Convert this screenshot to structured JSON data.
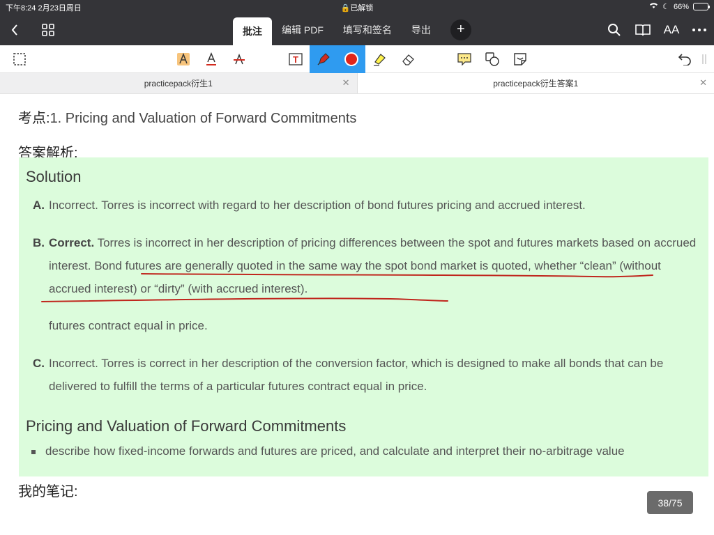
{
  "status": {
    "time_date": "下午8:24   2月23日周日",
    "lock": "已解锁",
    "battery": "66%",
    "battery_level": 0.66
  },
  "topbar": {
    "tabs": [
      {
        "label": "批注",
        "active": true
      },
      {
        "label": "编辑 PDF",
        "active": false
      },
      {
        "label": "填写和签名",
        "active": false
      },
      {
        "label": "导出",
        "active": false
      }
    ],
    "plus": "+",
    "font_size_label": "AA"
  },
  "doctabs": [
    {
      "label": "practicepack衍生1",
      "active": false
    },
    {
      "label": "practicepack衍生答案1",
      "active": true
    }
  ],
  "tools": {
    "text_box_label": "T"
  },
  "content": {
    "topic_prefix": "考点:",
    "topic": "1. Pricing and Valuation of Forward Commitments",
    "answer_heading": "答案解析:",
    "solution_title": "Solution",
    "items": [
      {
        "label": "A.",
        "text": "Incorrect. Torres is incorrect with regard to her description of bond futures pricing and accrued interest."
      },
      {
        "label": "B.",
        "bold": "Correct.",
        "text": " Torres is incorrect in her description of pricing differences between the spot and futures markets based on accrued interest. Bond futures are generally quoted in the same way the spot bond market is quoted, whether “clean” (without accrued interest) or “dirty” (with accrued interest)."
      },
      {
        "label": "",
        "text": "futures contract equal in price."
      },
      {
        "label": "C.",
        "text": "Incorrect. Torres is correct in her description of the conversion factor, which is designed to make all bonds that can be delivered to fulfill the terms of a particular futures contract equal in price."
      }
    ],
    "section_title": "Pricing and Valuation of Forward Commitments",
    "bullet": "describe how fixed-income forwards and futures are priced, and calculate and interpret their no-arbitrage value",
    "notes_heading": "我的笔记:"
  },
  "page_indicator": "38/75",
  "colors": {
    "bar": "#343438",
    "highlight_bg": "#dcfcdc",
    "ink": "#c0261d",
    "accent": "#2f9bf0"
  }
}
